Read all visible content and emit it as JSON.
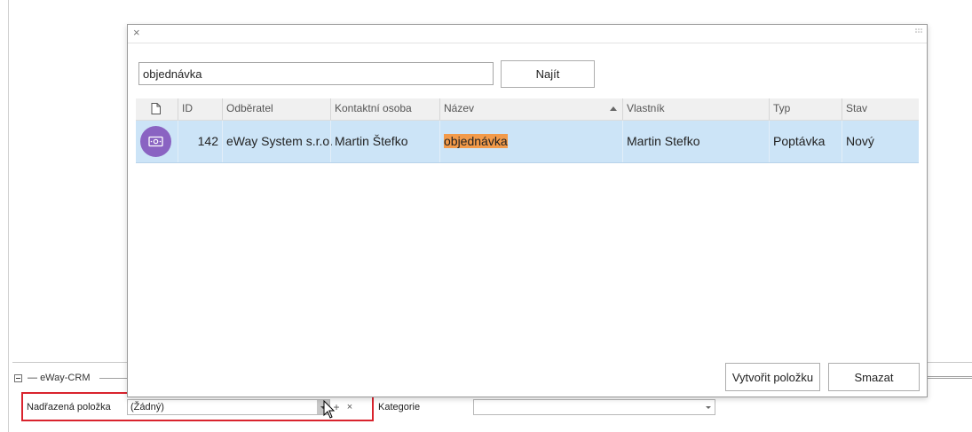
{
  "dialog": {
    "search_value": "objednávka",
    "search_button": "Najít",
    "columns": {
      "doc": "",
      "id": "ID",
      "customer": "Odběratel",
      "contact": "Kontaktní osoba",
      "name": "Název",
      "owner": "Vlastník",
      "type": "Typ",
      "state": "Stav"
    },
    "rows": [
      {
        "icon": "money-icon",
        "id": "142",
        "customer": "eWay System s.r.o.",
        "contact": "Martin Štefko",
        "name": "objednávka",
        "owner": "Martin Stefko",
        "type": "Poptávka",
        "state": "Nový"
      }
    ],
    "create_button": "Vytvořit položku",
    "delete_button": "Smazat"
  },
  "section": {
    "title": "eWay-CRM",
    "parent_label": "Nadřazená položka",
    "parent_value": "(Žádný)",
    "category_label": "Kategorie",
    "category_value": ""
  },
  "colors": {
    "selected_row": "#cce4f7",
    "search_hit": "#f29a4a",
    "avatar": "#8a63c2",
    "highlight_border": "#d9232d"
  }
}
